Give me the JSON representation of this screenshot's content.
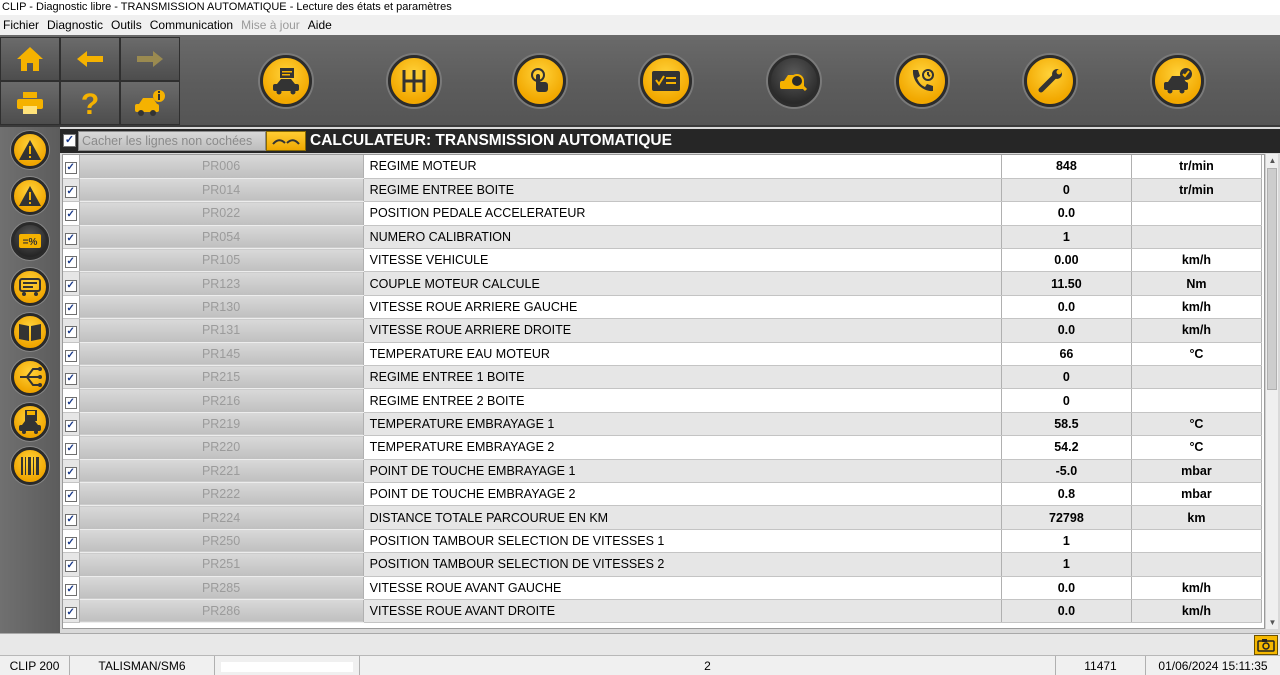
{
  "window_title": "CLIP - Diagnostic libre - TRANSMISSION AUTOMATIQUE - Lecture des états et paramètres",
  "menu": [
    {
      "label": "Fichier",
      "enabled": true
    },
    {
      "label": "Diagnostic",
      "enabled": true
    },
    {
      "label": "Outils",
      "enabled": true
    },
    {
      "label": "Communication",
      "enabled": true
    },
    {
      "label": "Mise à jour",
      "enabled": false
    },
    {
      "label": "Aide",
      "enabled": true
    }
  ],
  "colors": {
    "accent": "#f5b200",
    "toolbar_bg": "#5e5e5e",
    "header_bg": "#262626"
  },
  "toolbar": {
    "nav_icons": [
      "home-icon",
      "back-arrow-icon",
      "forward-arrow-icon",
      "printer-icon",
      "help-icon",
      "vehicle-info-icon"
    ],
    "main_icons": [
      "vehicle-identification-icon",
      "gearbox-icon",
      "touch-icon",
      "checklist-icon",
      "diagnostic-search-icon",
      "phone-support-icon",
      "wrench-icon",
      "vehicle-check-icon"
    ],
    "active_main_index": 4
  },
  "sidebar": {
    "icons": [
      "fault-warning-icon",
      "fault-warning-icon",
      "parameters-percent-icon",
      "states-icon",
      "documentation-book-icon",
      "wiring-icon",
      "save-vehicle-icon",
      "barcode-icon"
    ],
    "active_index": 2
  },
  "panel": {
    "hide_unchecked_label": "Cacher les lignes non cochées",
    "title": "CALCULATEUR: TRANSMISSION AUTOMATIQUE"
  },
  "rows": [
    {
      "code": "PR006",
      "label": "REGIME MOTEUR",
      "value": "848",
      "unit": "tr/min"
    },
    {
      "code": "PR014",
      "label": "REGIME ENTREE BOITE",
      "value": "0",
      "unit": "tr/min"
    },
    {
      "code": "PR022",
      "label": "POSITION PEDALE ACCELERATEUR",
      "value": "0.0",
      "unit": ""
    },
    {
      "code": "PR054",
      "label": "NUMERO CALIBRATION",
      "value": "1",
      "unit": ""
    },
    {
      "code": "PR105",
      "label": "VITESSE VEHICULE",
      "value": "0.00",
      "unit": "km/h"
    },
    {
      "code": "PR123",
      "label": "COUPLE MOTEUR CALCULE",
      "value": "11.50",
      "unit": "Nm"
    },
    {
      "code": "PR130",
      "label": "VITESSE ROUE ARRIERE GAUCHE",
      "value": "0.0",
      "unit": "km/h"
    },
    {
      "code": "PR131",
      "label": "VITESSE ROUE ARRIERE DROITE",
      "value": "0.0",
      "unit": "km/h"
    },
    {
      "code": "PR145",
      "label": "TEMPERATURE EAU MOTEUR",
      "value": "66",
      "unit": "°C"
    },
    {
      "code": "PR215",
      "label": "REGIME ENTREE 1 BOITE",
      "value": "0",
      "unit": ""
    },
    {
      "code": "PR216",
      "label": "REGIME ENTREE 2 BOITE",
      "value": "0",
      "unit": ""
    },
    {
      "code": "PR219",
      "label": "TEMPERATURE EMBRAYAGE 1",
      "value": "58.5",
      "unit": "°C"
    },
    {
      "code": "PR220",
      "label": "TEMPERATURE EMBRAYAGE 2",
      "value": "54.2",
      "unit": "°C"
    },
    {
      "code": "PR221",
      "label": "POINT DE TOUCHE EMBRAYAGE 1",
      "value": "-5.0",
      "unit": "mbar"
    },
    {
      "code": "PR222",
      "label": "POINT DE TOUCHE EMBRAYAGE 2",
      "value": "0.8",
      "unit": "mbar"
    },
    {
      "code": "PR224",
      "label": "DISTANCE TOTALE PARCOURUE EN KM",
      "value": "72798",
      "unit": "km"
    },
    {
      "code": "PR250",
      "label": "POSITION TAMBOUR SELECTION DE VITESSES 1",
      "value": "1",
      "unit": ""
    },
    {
      "code": "PR251",
      "label": "POSITION TAMBOUR SELECTION DE VITESSES 2",
      "value": "1",
      "unit": ""
    },
    {
      "code": "PR285",
      "label": "VITESSE ROUE AVANT GAUCHE",
      "value": "0.0",
      "unit": "km/h"
    },
    {
      "code": "PR286",
      "label": "VITESSE ROUE AVANT DROITE",
      "value": "0.0",
      "unit": "km/h"
    }
  ],
  "status": {
    "tool": "CLIP 200",
    "vehicle": "TALISMAN/SM6",
    "vin_redacted": true,
    "page": "2",
    "code": "11471",
    "datetime": "01/06/2024 15:11:35"
  }
}
